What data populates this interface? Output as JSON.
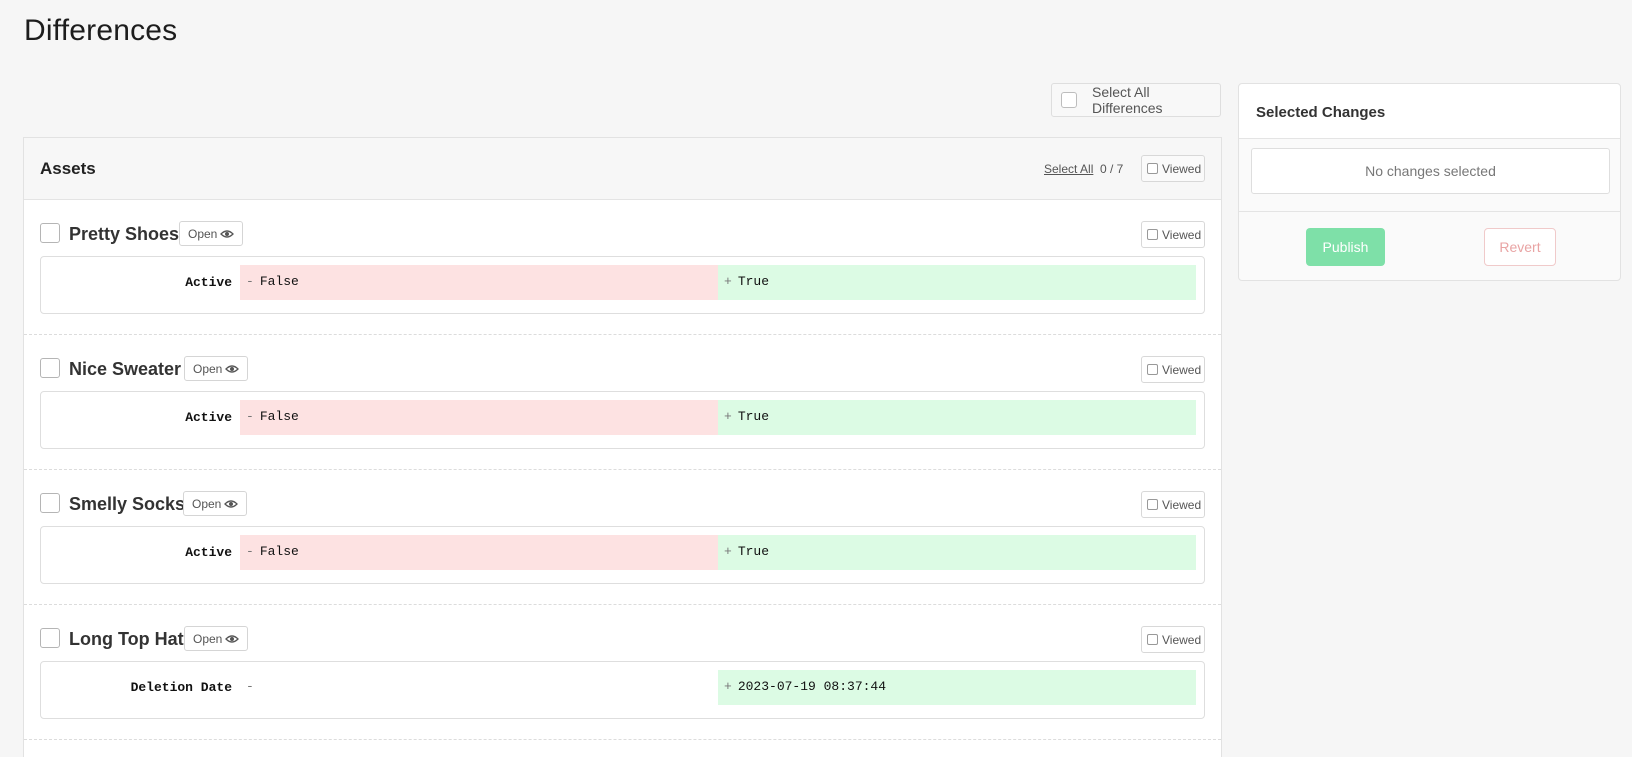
{
  "page": {
    "title": "Differences"
  },
  "select_all_differences": {
    "label": "Select All Differences"
  },
  "assets": {
    "title": "Assets",
    "select_all_label": "Select All",
    "count": "0 / 7",
    "viewed_label": "Viewed",
    "items": [
      {
        "name": "Pretty Shoes",
        "open_label": "Open",
        "viewed_label": "Viewed",
        "field": "Active",
        "old_sign": "-",
        "old_value": "False",
        "new_sign": "+",
        "new_value": "True"
      },
      {
        "name": "Nice Sweater",
        "open_label": "Open",
        "viewed_label": "Viewed",
        "field": "Active",
        "old_sign": "-",
        "old_value": "False",
        "new_sign": "+",
        "new_value": "True"
      },
      {
        "name": "Smelly Socks",
        "open_label": "Open",
        "viewed_label": "Viewed",
        "field": "Active",
        "old_sign": "-",
        "old_value": "False",
        "new_sign": "+",
        "new_value": "True"
      },
      {
        "name": "Long Top Hat",
        "open_label": "Open",
        "viewed_label": "Viewed",
        "field": "Deletion Date",
        "old_sign": "-",
        "old_value": "",
        "new_sign": "+",
        "new_value": "2023-07-19 08:37:44"
      }
    ]
  },
  "selected_changes": {
    "title": "Selected Changes",
    "empty_text": "No changes selected",
    "publish_label": "Publish",
    "revert_label": "Revert"
  },
  "colors": {
    "removed_bg": "#fde2e2",
    "added_bg": "#dcfbe4",
    "publish_bg": "#7ee0a8",
    "revert_text": "#e9a4a4"
  },
  "icons": {
    "open": "eye-icon"
  }
}
